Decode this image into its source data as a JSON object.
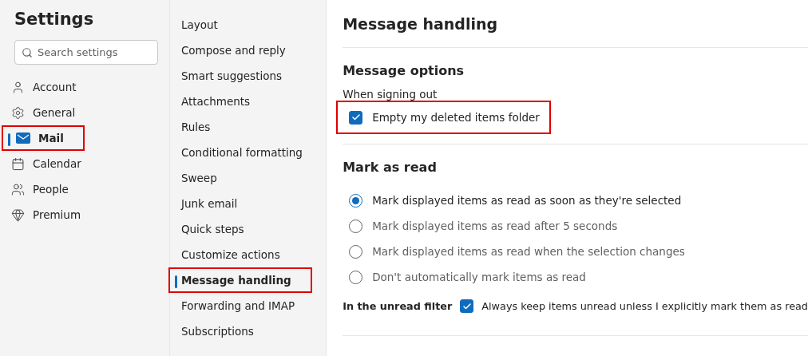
{
  "sidebar": {
    "title": "Settings",
    "search": {
      "placeholder": "Search settings"
    },
    "items": [
      {
        "label": "Account",
        "selected": false,
        "highlighted": false
      },
      {
        "label": "General",
        "selected": false,
        "highlighted": false
      },
      {
        "label": "Mail",
        "selected": true,
        "highlighted": true
      },
      {
        "label": "Calendar",
        "selected": false,
        "highlighted": false
      },
      {
        "label": "People",
        "selected": false,
        "highlighted": false
      },
      {
        "label": "Premium",
        "selected": false,
        "highlighted": false
      }
    ]
  },
  "subnav": {
    "items": [
      {
        "label": "Layout",
        "selected": false,
        "highlighted": false
      },
      {
        "label": "Compose and reply",
        "selected": false,
        "highlighted": false
      },
      {
        "label": "Smart suggestions",
        "selected": false,
        "highlighted": false
      },
      {
        "label": "Attachments",
        "selected": false,
        "highlighted": false
      },
      {
        "label": "Rules",
        "selected": false,
        "highlighted": false
      },
      {
        "label": "Conditional formatting",
        "selected": false,
        "highlighted": false
      },
      {
        "label": "Sweep",
        "selected": false,
        "highlighted": false
      },
      {
        "label": "Junk email",
        "selected": false,
        "highlighted": false
      },
      {
        "label": "Quick steps",
        "selected": false,
        "highlighted": false
      },
      {
        "label": "Customize actions",
        "selected": false,
        "highlighted": false
      },
      {
        "label": "Message handling",
        "selected": true,
        "highlighted": true
      },
      {
        "label": "Forwarding and IMAP",
        "selected": false,
        "highlighted": false
      },
      {
        "label": "Subscriptions",
        "selected": false,
        "highlighted": false
      }
    ]
  },
  "content": {
    "title": "Message handling",
    "message_options": {
      "heading": "Message options",
      "label": "When signing out",
      "checkbox": {
        "label": "Empty my deleted items folder",
        "checked": true,
        "highlighted": true
      }
    },
    "mark_as_read": {
      "heading": "Mark as read",
      "options": [
        {
          "label": "Mark displayed items as read as soon as they're selected",
          "selected": true
        },
        {
          "label": "Mark displayed items as read after 5 seconds",
          "selected": false
        },
        {
          "label": "Mark displayed items as read when the selection changes",
          "selected": false
        },
        {
          "label": "Don't automatically mark items as read",
          "selected": false
        }
      ],
      "unread_filter": {
        "label": "In the unread filter",
        "checkbox": {
          "label": "Always keep items unread unless I explicitly mark them as read",
          "checked": true
        }
      }
    }
  }
}
